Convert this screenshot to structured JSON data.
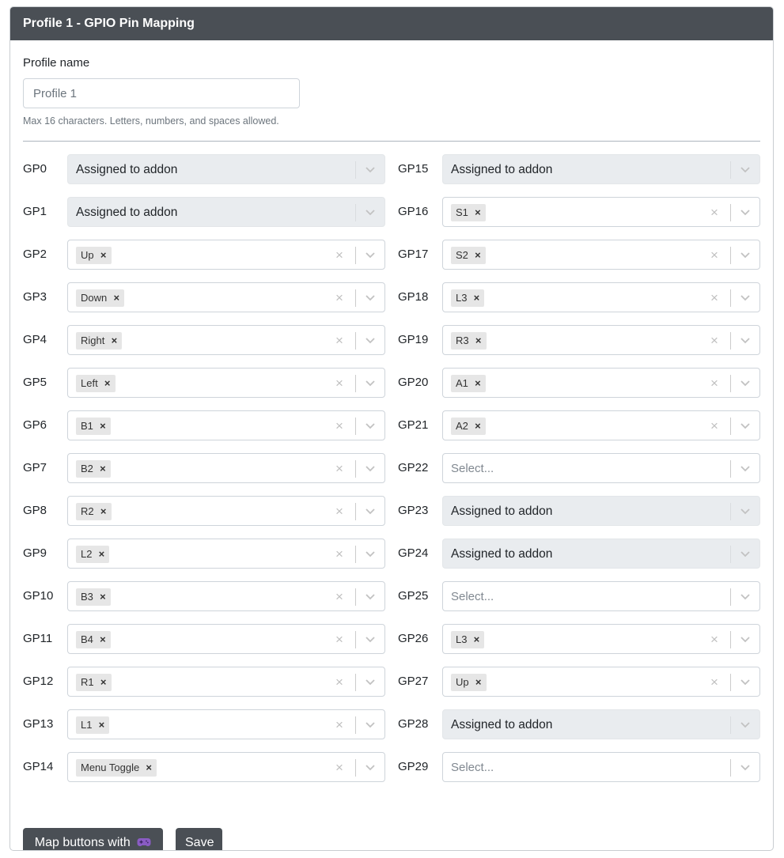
{
  "header": {
    "title": "Profile 1 - GPIO Pin Mapping"
  },
  "profile": {
    "label": "Profile name",
    "value": "Profile 1",
    "help": "Max 16 characters. Letters, numbers, and spaces allowed."
  },
  "placeholder": "Select...",
  "pins_left": [
    {
      "pin": "GP0",
      "type": "addon",
      "value": "Assigned to addon"
    },
    {
      "pin": "GP1",
      "type": "addon",
      "value": "Assigned to addon"
    },
    {
      "pin": "GP2",
      "type": "chip",
      "value": "Up"
    },
    {
      "pin": "GP3",
      "type": "chip",
      "value": "Down"
    },
    {
      "pin": "GP4",
      "type": "chip",
      "value": "Right"
    },
    {
      "pin": "GP5",
      "type": "chip",
      "value": "Left"
    },
    {
      "pin": "GP6",
      "type": "chip",
      "value": "B1"
    },
    {
      "pin": "GP7",
      "type": "chip",
      "value": "B2"
    },
    {
      "pin": "GP8",
      "type": "chip",
      "value": "R2"
    },
    {
      "pin": "GP9",
      "type": "chip",
      "value": "L2"
    },
    {
      "pin": "GP10",
      "type": "chip",
      "value": "B3"
    },
    {
      "pin": "GP11",
      "type": "chip",
      "value": "B4"
    },
    {
      "pin": "GP12",
      "type": "chip",
      "value": "R1"
    },
    {
      "pin": "GP13",
      "type": "chip",
      "value": "L1"
    },
    {
      "pin": "GP14",
      "type": "chip",
      "value": "Menu Toggle"
    }
  ],
  "pins_right": [
    {
      "pin": "GP15",
      "type": "addon",
      "value": "Assigned to addon"
    },
    {
      "pin": "GP16",
      "type": "chip",
      "value": "S1"
    },
    {
      "pin": "GP17",
      "type": "chip",
      "value": "S2"
    },
    {
      "pin": "GP18",
      "type": "chip",
      "value": "L3"
    },
    {
      "pin": "GP19",
      "type": "chip",
      "value": "R3"
    },
    {
      "pin": "GP20",
      "type": "chip",
      "value": "A1"
    },
    {
      "pin": "GP21",
      "type": "chip",
      "value": "A2"
    },
    {
      "pin": "GP22",
      "type": "empty",
      "value": ""
    },
    {
      "pin": "GP23",
      "type": "addon",
      "value": "Assigned to addon"
    },
    {
      "pin": "GP24",
      "type": "addon",
      "value": "Assigned to addon"
    },
    {
      "pin": "GP25",
      "type": "empty",
      "value": ""
    },
    {
      "pin": "GP26",
      "type": "chip",
      "value": "L3"
    },
    {
      "pin": "GP27",
      "type": "chip",
      "value": "Up"
    },
    {
      "pin": "GP28",
      "type": "addon",
      "value": "Assigned to addon"
    },
    {
      "pin": "GP29",
      "type": "empty",
      "value": ""
    }
  ],
  "buttons": {
    "map_label": "Map buttons with",
    "map_icon": "gamepad-icon",
    "save_label": "Save"
  },
  "colors": {
    "header_bg": "#4a4f55",
    "button_bg": "#4a4f55",
    "disabled_bg": "#e9ecef",
    "chip_bg": "#e6e6e6"
  }
}
